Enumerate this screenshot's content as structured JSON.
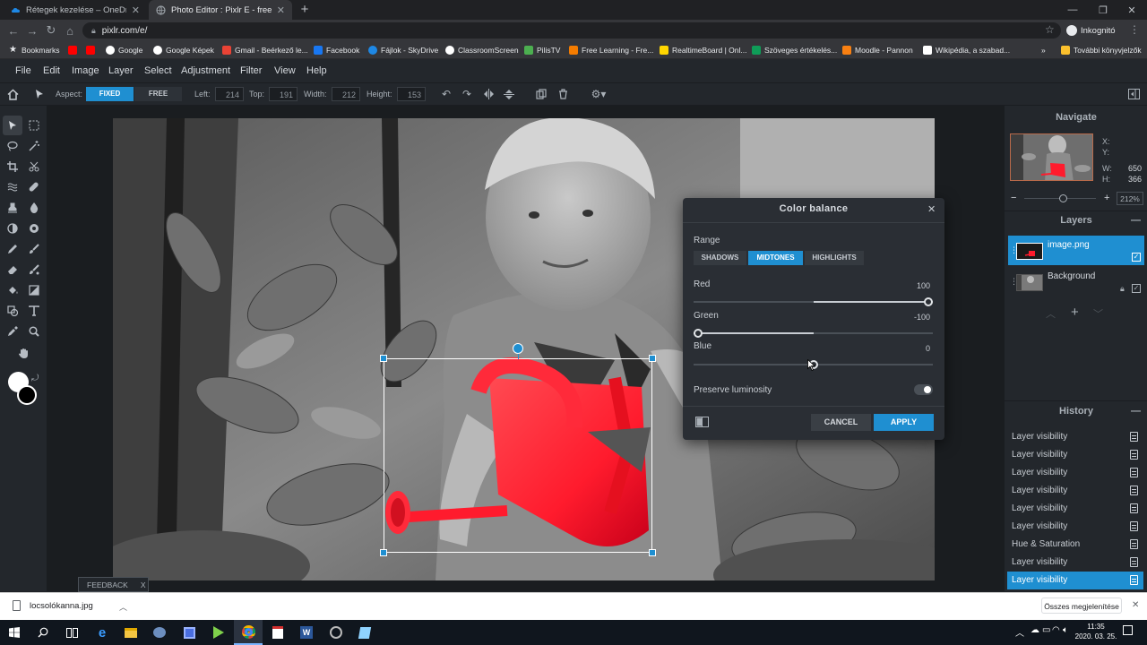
{
  "browser": {
    "tabs": [
      {
        "title": "Rétegek kezelése – OneDrive",
        "active": false
      },
      {
        "title": "Photo Editor : Pixlr E - free image",
        "active": true
      }
    ],
    "new_tab": "+",
    "url": "pixlr.com/e/",
    "incognito_label": "Inkognitó",
    "bookmarks": [
      "Bookmarks",
      "",
      "",
      "Google",
      "Google Képek",
      "Gmail - Beérkező le...",
      "Facebook",
      "Fájlok - SkyDrive",
      "ClassroomScreen",
      "PilisTV",
      "Free Learning - Fre...",
      "RealtimeBoard | Onl...",
      "Szöveges értékelés...",
      "Moodle - Pannon",
      "Wikipédia, a szabad..."
    ],
    "bookmarks_more": "»",
    "other_bookmarks": "További könyvjelzők"
  },
  "menu": {
    "items": [
      "File",
      "Edit",
      "Image",
      "Layer",
      "Select",
      "Adjustment",
      "Filter",
      "View",
      "Help"
    ]
  },
  "options": {
    "aspect_label": "Aspect:",
    "fixed": "FIXED",
    "free": "FREE",
    "left_label": "Left:",
    "left_value": "214",
    "top_label": "Top:",
    "top_value": "191",
    "width_label": "Width:",
    "width_value": "212",
    "height_label": "Height:",
    "height_value": "153"
  },
  "navigate": {
    "title": "Navigate",
    "x_label": "X:",
    "x_value": "",
    "y_label": "Y:",
    "y_value": "",
    "w_label": "W:",
    "w_value": "650",
    "h_label": "H:",
    "h_value": "366",
    "zoom": "212%",
    "zoom_level": 0.55
  },
  "layers": {
    "title": "Layers",
    "items": [
      {
        "name": "image.png",
        "active": true
      },
      {
        "name": "Background",
        "active": false
      }
    ]
  },
  "history": {
    "title": "History",
    "items": [
      "Layer visibility",
      "Layer visibility",
      "Layer visibility",
      "Layer visibility",
      "Layer visibility",
      "Layer visibility",
      "Hue & Saturation",
      "Layer visibility",
      "Layer visibility"
    ]
  },
  "dialog": {
    "title": "Color balance",
    "close": "✕",
    "range_label": "Range",
    "ranges": [
      "SHADOWS",
      "MIDTONES",
      "HIGHLIGHTS"
    ],
    "selected_range": "MIDTONES",
    "sliders": [
      {
        "label": "Red",
        "value": "100",
        "min": -100,
        "max": 100
      },
      {
        "label": "Green",
        "value": "-100",
        "min": -100,
        "max": 100
      },
      {
        "label": "Blue",
        "value": "0",
        "min": -100,
        "max": 100
      }
    ],
    "preserve_label": "Preserve luminosity",
    "preserve_on": true,
    "cancel": "CANCEL",
    "apply": "APPLY"
  },
  "feedback": {
    "label": "FEEDBACK",
    "close": "X"
  },
  "download": {
    "file": "locsolókanna.jpg",
    "show_all": "Összes megjelenítése",
    "close": "✕"
  },
  "taskbar": {
    "time": "11:35",
    "date": "2020. 03. 25."
  },
  "colors": {
    "accent": "#1f8fd1",
    "panel": "#23272c",
    "canvas_bg": "#1a1d20",
    "can_red": "#ff1b2d"
  }
}
